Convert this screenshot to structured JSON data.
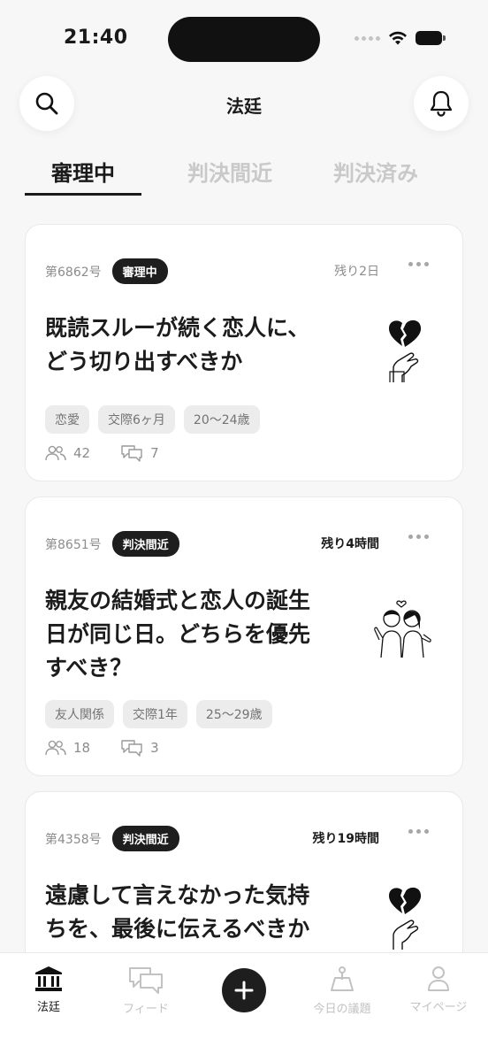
{
  "status_bar": {
    "time": "21:40"
  },
  "header": {
    "title": "法廷"
  },
  "tabs": [
    {
      "label": "審理中",
      "active": true
    },
    {
      "label": "判決間近",
      "active": false
    },
    {
      "label": "判決済み",
      "active": false
    }
  ],
  "cards": [
    {
      "case_no": "第6862号",
      "badge": "審理中",
      "remaining": "残り2日",
      "title_lines": [
        "既読スルーが続く恋人に、",
        "どう切り出すべきか"
      ],
      "illustration": "broken-heart-hand",
      "tags": [
        "恋愛",
        "交際6ヶ月",
        "20〜24歳"
      ],
      "participants": "42",
      "comments": "7"
    },
    {
      "case_no": "第8651号",
      "badge": "判決間近",
      "remaining": "残り4時間",
      "title_lines": [
        "親友の結婚式と恋人の誕生",
        "日が同じ日。どちらを優先",
        "すべき？"
      ],
      "illustration": "couple",
      "tags": [
        "友人関係",
        "交際1年",
        "25〜29歳"
      ],
      "participants": "18",
      "comments": "3"
    },
    {
      "case_no": "第4358号",
      "badge": "判決間近",
      "remaining": "残り19時間",
      "title_lines": [
        "遠慮して言えなかった気持",
        "ちを、最後に伝えるべきか"
      ],
      "illustration": "broken-heart-hand"
    }
  ],
  "bottom_nav": [
    {
      "label": "法廷",
      "icon": "courthouse-icon",
      "active": true
    },
    {
      "label": "フィード",
      "icon": "chat-bubbles-icon",
      "active": false
    },
    {
      "label": "",
      "icon": "plus-icon",
      "active": false
    },
    {
      "label": "今日の議題",
      "icon": "scale-icon",
      "active": false
    },
    {
      "label": "マイページ",
      "icon": "person-icon",
      "active": false
    }
  ],
  "colors": {
    "accent": "#1e1e1e",
    "background": "#f7f7f7",
    "muted": "#c2c2c2"
  }
}
